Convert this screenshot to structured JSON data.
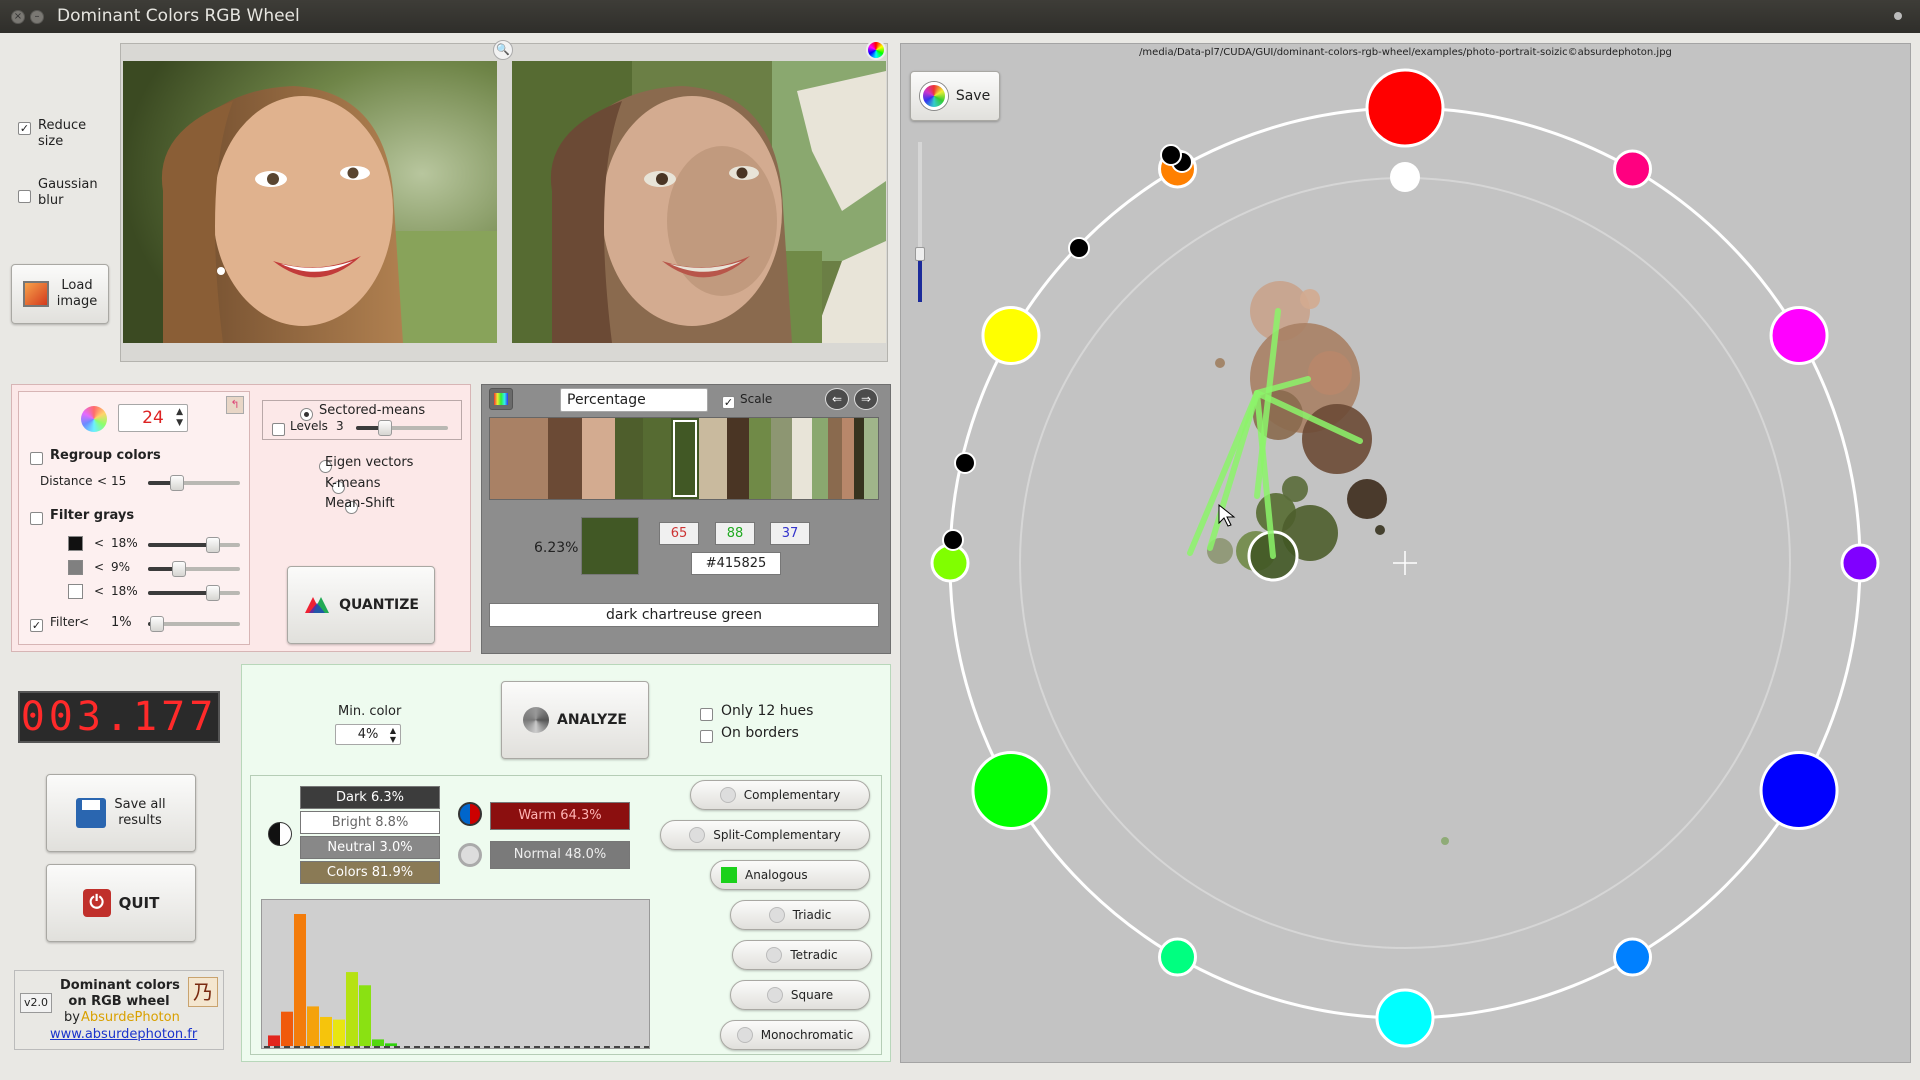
{
  "window": {
    "title": "Dominant Colors RGB Wheel"
  },
  "options": {
    "reduce_size": {
      "label": "Reduce\nsize",
      "checked": true
    },
    "gaussian_blur": {
      "label": "Gaussian\nblur",
      "checked": false
    },
    "load_image": "Load\nimage"
  },
  "quantize": {
    "color_count": "24",
    "regroup_colors": "Regroup colors",
    "distance_label": "Distance",
    "distance_lt": "<",
    "distance_value": "15",
    "filter_grays": "Filter grays",
    "gray_rows": [
      {
        "color": "#111111",
        "lt": "<",
        "value": "18%",
        "level": 0.72
      },
      {
        "color": "#808080",
        "lt": "<",
        "value": "9%",
        "level": 0.3
      },
      {
        "color": "#ffffff",
        "lt": "<",
        "value": "18%",
        "level": 0.72
      }
    ],
    "filter_label": "Filter",
    "filter_lt": "<",
    "filter_value": "1%",
    "algorithms": [
      {
        "label": "Sectored-means",
        "selected": true
      },
      {
        "label": "Eigen vectors",
        "selected": false
      },
      {
        "label": "K-means",
        "selected": false
      },
      {
        "label": "Mean-Shift",
        "selected": false
      }
    ],
    "levels_label": "Levels",
    "levels_value": "3",
    "button": "QUANTIZE"
  },
  "palette": {
    "sort_mode": "Percentage",
    "scale_label": "Scale",
    "swatches": [
      "#a98165",
      "#6b4a35",
      "#d3ab90",
      "#4e5e2c",
      "#566b32",
      "#415825",
      "#c9ba9e",
      "#4a3524",
      "#708a47",
      "#8d9672",
      "#e8e4d8",
      "#8aa86f",
      "#8a6a4e",
      "#b8876a",
      "#37331f",
      "#a0b58a"
    ],
    "selected_index": 5,
    "percent": "6.23%",
    "selected_color": "#415825",
    "r": "65",
    "g": "88",
    "b": "37",
    "hex": "#415825",
    "name": "dark chartreuse green"
  },
  "timer": "003.177",
  "save_all": "Save all\nresults",
  "quit": "QUIT",
  "about": {
    "version": "v2.0",
    "title": "Dominant colors\non RGB wheel",
    "by": "by",
    "author": "AbsurdePhoton",
    "url": "www.absurdephoton.fr"
  },
  "analyze": {
    "min_color_label": "Min. color",
    "min_color_value": "4%",
    "button": "ANALYZE",
    "only_12_hues": "Only 12 hues",
    "on_borders": "On borders"
  },
  "stats": {
    "dark": "Dark 6.3%",
    "bright": "Bright 8.8%",
    "neutral": "Neutral 3.0%",
    "colors": "Colors 81.9%",
    "warm": "Warm 64.3%",
    "normal": "Normal 48.0%"
  },
  "histogram": [
    {
      "color": "#e2261e",
      "v": 0.08
    },
    {
      "color": "#f05a0c",
      "v": 0.26
    },
    {
      "color": "#f37c0b",
      "v": 1.0
    },
    {
      "color": "#f5a20c",
      "v": 0.3
    },
    {
      "color": "#f6c40c",
      "v": 0.22
    },
    {
      "color": "#e8e512",
      "v": 0.2
    },
    {
      "color": "#b6e212",
      "v": 0.56
    },
    {
      "color": "#8ae112",
      "v": 0.46
    },
    {
      "color": "#53d80f",
      "v": 0.05
    },
    {
      "color": "#2fd10c",
      "v": 0.02
    }
  ],
  "harmonies": [
    "Complementary",
    "Split-Complementary",
    "Analogous",
    "Triadic",
    "Tetradic",
    "Square",
    "Monochromatic"
  ],
  "wheel": {
    "path": "/media/Data-pl7/CUDA/GUI/dominant-colors-rgb-wheel/examples/photo-portrait-soizic©absurdephoton.jpg",
    "save": "Save"
  }
}
